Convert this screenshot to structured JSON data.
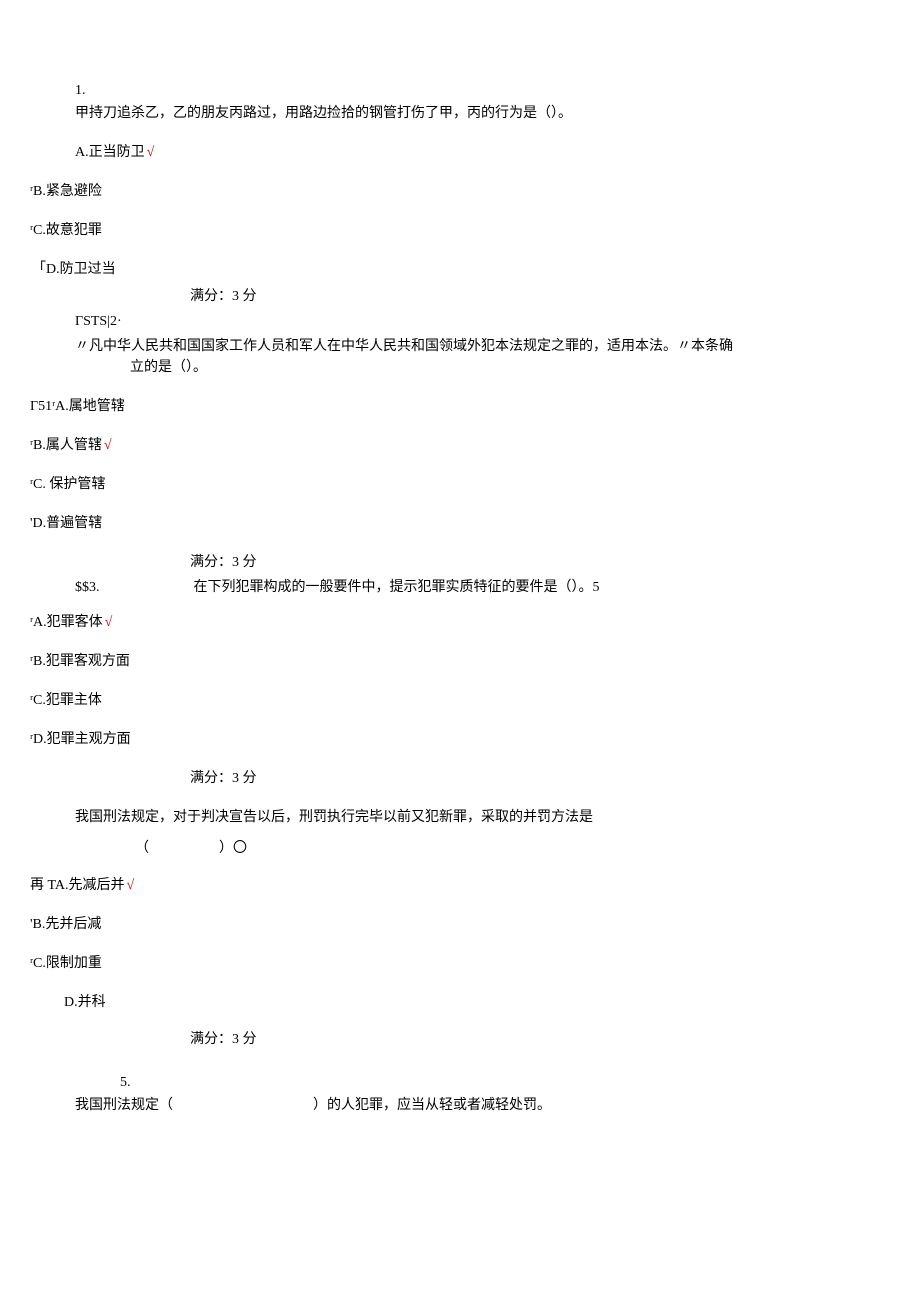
{
  "q1": {
    "num": "1.",
    "stem": "甲持刀追杀乙，乙的朋友丙路过，用路边捡拾的钢管打伤了甲，丙的行为是（）。",
    "A_prefix": "A.",
    "A": "正当防卫",
    "A_tick": "√",
    "B_prefix": "ʳB.",
    "B": "紧急避险",
    "C_prefix": "ʳC.",
    "C": "故意犯罪",
    "D_prefix": "「D.",
    "D": "防卫过当",
    "score": "满分：3 分"
  },
  "q2": {
    "header": "ΓSTS|2·",
    "stem_l1": "〃凡中华人民共和国国家工作人员和军人在中华人民共和国领域外犯本法规定之罪的，适用本法。〃本条确",
    "stem_l2": "立的是（）。",
    "A_prefix": "Γ51ʳA.",
    "A": "属地管辖",
    "B_prefix": "ʳB.",
    "B": "属人管辖",
    "B_tick": "√",
    "C_prefix": "ʳC. ",
    "C": "保护管辖",
    "D_prefix": "'D.",
    "D": "普遍管辖",
    "score": "满分：3 分"
  },
  "q3": {
    "col1": "$$3.",
    "stem": "在下列犯罪构成的一般要件中，提示犯罪实质特征的要件是（）。5",
    "A_prefix": "ʳA.",
    "A": "犯罪客体",
    "A_tick": "√",
    "B_prefix": "ʳB.",
    "B": "犯罪客观方面",
    "C_prefix": "ʳC.",
    "C": "犯罪主体",
    "D_prefix": "ʳD.",
    "D": "犯罪主观方面",
    "score": "满分：3 分"
  },
  "q4": {
    "stem": "我国刑法规定，对于判决宣告以后，刑罚执行完毕以前又犯新罪，采取的并罚方法是",
    "paren": "（　　　　　）〇",
    "A_prefix": "再 TA.",
    "A": "先减后并",
    "A_tick": "√",
    "B_prefix": "'B.",
    "B": "先并后减",
    "C_prefix": "ʳC.",
    "C": "限制加重",
    "D_prefix": "D.",
    "D": "并科",
    "score": "满分：3 分"
  },
  "q5": {
    "num": "5.",
    "stem": "我国刑法规定（　　　　　　　　　　）的人犯罪，应当从轻或者减轻处罚。"
  }
}
